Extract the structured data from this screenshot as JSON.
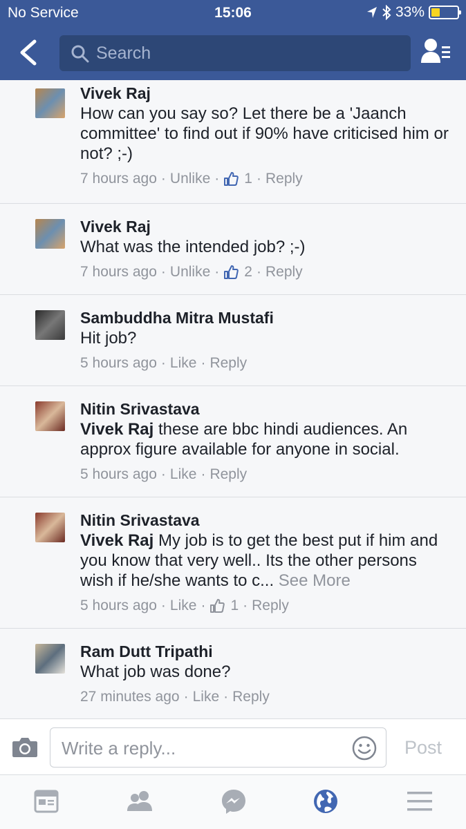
{
  "status_bar": {
    "carrier": "No Service",
    "time": "15:06",
    "battery": "33%",
    "battery_level": 0.33
  },
  "header": {
    "search_placeholder": "Search"
  },
  "comments": [
    {
      "name": "Vivek Raj",
      "mention": "",
      "text": "How can you say so? Let there be a 'Jaanch committee' to find out if 90% have criticised him or not? ;-)",
      "see_more": "",
      "time": "7 hours ago",
      "like_label": "Unlike",
      "like_count": "1",
      "reply_label": "Reply",
      "avatar_icon": "user-avatar-icon"
    },
    {
      "name": "Vivek Raj",
      "mention": "",
      "text": "What was the intended job? ;-)",
      "see_more": "",
      "time": "7 hours ago",
      "like_label": "Unlike",
      "like_count": "2",
      "reply_label": "Reply",
      "avatar_icon": "user-avatar-icon"
    },
    {
      "name": "Sambuddha Mitra Mustafi",
      "mention": "",
      "text": "Hit job?",
      "see_more": "",
      "time": "5 hours ago",
      "like_label": "Like",
      "like_count": "",
      "reply_label": "Reply",
      "avatar_icon": "user-avatar-icon"
    },
    {
      "name": "Nitin Srivastava",
      "mention": "Vivek Raj",
      "text": " these are bbc hindi audiences. An approx figure available for anyone in social.",
      "see_more": "",
      "time": "5 hours ago",
      "like_label": "Like",
      "like_count": "",
      "reply_label": "Reply",
      "avatar_icon": "user-avatar-icon"
    },
    {
      "name": "Nitin Srivastava",
      "mention": "Vivek Raj",
      "text": " My job is to get the best put if him and you know that very well.. Its the other persons wish if he/she wants to c...",
      "see_more": "See More",
      "time": "5 hours ago",
      "like_label": "Like",
      "like_count": "1",
      "reply_label": "Reply",
      "avatar_icon": "user-avatar-icon"
    },
    {
      "name": "Ram Dutt Tripathi",
      "mention": "",
      "text": "What job was done?",
      "see_more": "",
      "time": "27 minutes ago",
      "like_label": "Like",
      "like_count": "",
      "reply_label": "Reply",
      "avatar_icon": "user-avatar-icon"
    }
  ],
  "reply_bar": {
    "placeholder": "Write a reply...",
    "post_label": "Post"
  },
  "tab_bar": {
    "icons": [
      "news-feed-icon",
      "friends-icon",
      "messenger-icon",
      "notifications-globe-icon",
      "menu-icon"
    ],
    "active": "notifications-globe-icon"
  },
  "colors": {
    "brand": "#3b5998",
    "like_blue": "#4267b2",
    "meta_gray": "#90949c"
  }
}
